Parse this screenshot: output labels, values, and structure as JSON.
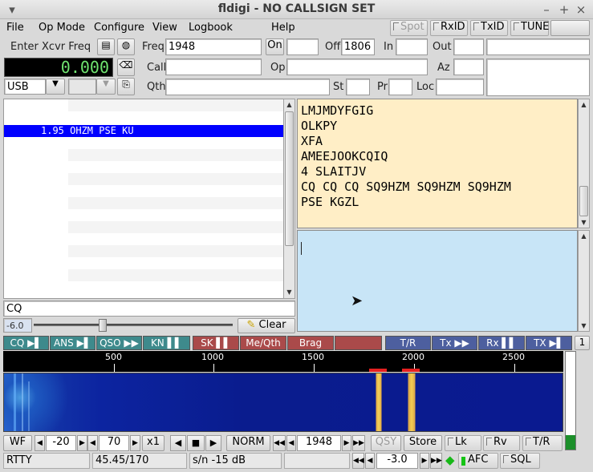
{
  "window": {
    "title": "fldigi - NO CALLSIGN SET"
  },
  "menu": [
    "File",
    "Op Mode",
    "Configure",
    "View",
    "Logbook",
    "Help"
  ],
  "toolbar": {
    "spot": "Spot",
    "rxid": "RxID",
    "txid": "TxID",
    "tune": "TUNE"
  },
  "rig": {
    "enter_label": "Enter Xcvr Freq",
    "freq_display": "0.000",
    "mode": "USB"
  },
  "log": {
    "freq_label": "Freq",
    "freq_value": "1948",
    "on_label": "On",
    "on_value": "",
    "off_label": "Off",
    "off_value": "1806",
    "in_label": "In",
    "in_value": "",
    "out_label": "Out",
    "out_value": "",
    "call_label": "Call",
    "call_value": "",
    "op_label": "Op",
    "op_value": "",
    "az_label": "Az",
    "az_value": "",
    "qth_label": "Qth",
    "qth_value": "",
    "st_label": "St",
    "st_value": "",
    "pr_label": "Pr",
    "pr_value": "",
    "loc_label": "Loc",
    "loc_value": ""
  },
  "browser": {
    "selected_row": "1.95 OHZM PSE KU",
    "search_value": "CQ",
    "squelch_value": "-6.0",
    "squelch_level": 0.34,
    "clear_label": "Clear"
  },
  "rx_text": [
    "LMJMDYFGIG",
    "OLKPY",
    "XFA",
    "AMEEJOOKCQIQ",
    "4 SLAITJV",
    "CQ CQ CQ SQ9HZM SQ9HZM SQ9HZM",
    "PSE KGZL"
  ],
  "macros": [
    {
      "label": "CQ ▶▌",
      "color": "teal"
    },
    {
      "label": "ANS ▶▌",
      "color": "teal"
    },
    {
      "label": "QSO ▶▶",
      "color": "teal"
    },
    {
      "label": "KN ▌▌",
      "color": "teal"
    },
    {
      "label": "SK ▌▌",
      "color": "red"
    },
    {
      "label": "Me/Qth",
      "color": "red"
    },
    {
      "label": "Brag",
      "color": "red"
    },
    {
      "label": "",
      "color": "red"
    },
    {
      "label": "T/R",
      "color": "blue"
    },
    {
      "label": "Tx ▶▶",
      "color": "blue"
    },
    {
      "label": "Rx ▌▌",
      "color": "blue"
    },
    {
      "label": "TX ▶▌",
      "color": "blue"
    }
  ],
  "macro_set": "1",
  "scale_labels": [
    "500",
    "1000",
    "1500",
    "2000",
    "2500"
  ],
  "waterfall_controls": {
    "wf_label": "WF",
    "ref_level": "-20",
    "range": "70",
    "zoom": "x1",
    "speed": "NORM",
    "carrier": "1948",
    "qsy": "QSY",
    "store": "Store",
    "lk": "Lk",
    "rv": "Rv",
    "tr": "T/R"
  },
  "statusbar": {
    "mode": "RTTY",
    "params": "45.45/170",
    "sn": "s/n -15 dB",
    "imd": "",
    "offset": "-3.0",
    "afc": "AFC",
    "sql": "SQL"
  }
}
